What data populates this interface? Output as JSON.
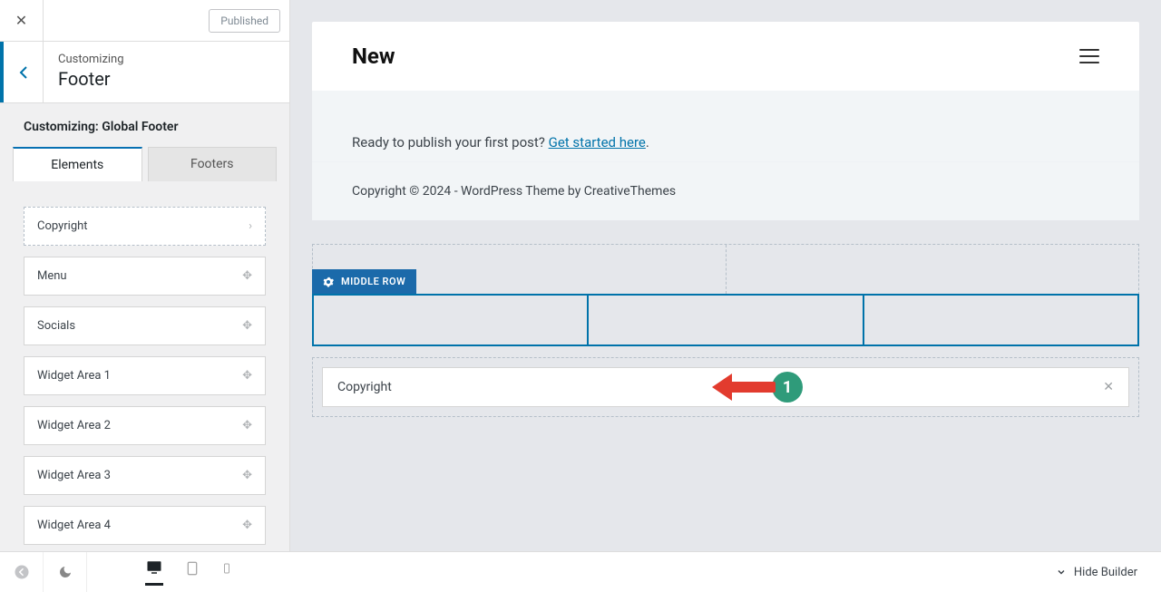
{
  "header": {
    "close": "✕",
    "published": "Published",
    "customizing": "Customizing",
    "title": "Footer"
  },
  "section_title": "Customizing: Global Footer",
  "tabs": {
    "elements": "Elements",
    "footers": "Footers"
  },
  "elements": {
    "copyright": "Copyright",
    "menu": "Menu",
    "socials": "Socials",
    "widget1": "Widget Area 1",
    "widget2": "Widget Area 2",
    "widget3": "Widget Area 3",
    "widget4": "Widget Area 4"
  },
  "preview": {
    "site_title": "New",
    "body_text": "Ready to publish your first post? ",
    "link_text": "Get started here",
    "footer_text": "Copyright © 2024 - WordPress Theme by CreativeThemes"
  },
  "builder": {
    "middle_label": "MIDDLE ROW",
    "bottom_item": "Copyright"
  },
  "annotation": {
    "step": "1"
  },
  "bottombar": {
    "hide": "Hide Builder"
  }
}
